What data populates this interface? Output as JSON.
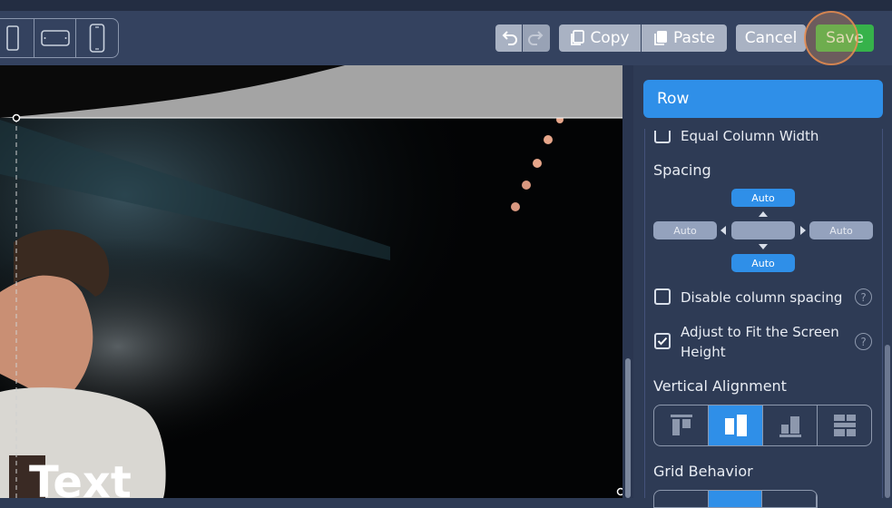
{
  "toolbar": {
    "device_icons": [
      "desktop-icon",
      "tablet-landscape-icon",
      "mobile-icon"
    ],
    "undo_icon": "undo-icon",
    "redo_icon": "redo-icon",
    "copy_label": "Copy",
    "paste_label": "Paste",
    "cancel_label": "Cancel",
    "save_label": "Save"
  },
  "canvas": {
    "heading_text": "Text"
  },
  "panel": {
    "header_title": "Row",
    "equal_column_width_label": "Equal Column Width",
    "equal_column_width_checked": false,
    "spacing_title": "Spacing",
    "spacing": {
      "top": "Auto",
      "left": "Auto",
      "center": "",
      "right": "Auto",
      "bottom": "Auto"
    },
    "disable_column_spacing_label": "Disable column spacing",
    "disable_column_spacing_checked": false,
    "adjust_fit_label_line1": "Adjust to Fit the Screen",
    "adjust_fit_label_line2": "Height",
    "adjust_fit_checked": true,
    "help_glyph": "?",
    "vertical_alignment_title": "Vertical Alignment",
    "vertical_alignment_options": [
      "top",
      "middle",
      "bottom",
      "stretch"
    ],
    "vertical_alignment_selected": "middle",
    "grid_behavior_title": "Grid Behavior"
  },
  "colors": {
    "accent": "#2f8fe8",
    "save_green": "#36b24a",
    "panel_bg": "#2e3b55",
    "toolbar_bg": "#34425f"
  }
}
